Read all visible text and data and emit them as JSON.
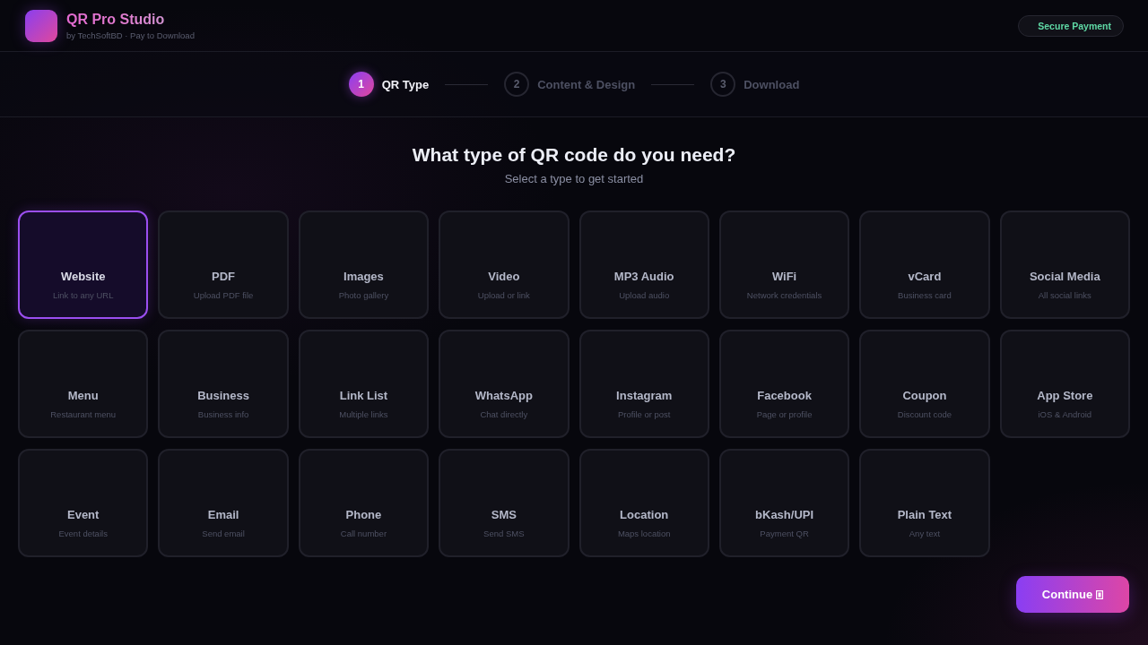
{
  "header": {
    "title": "QR Pro Studio",
    "subtitle": "by TechSoftBD · Pay to Download",
    "badge": "Secure Payment"
  },
  "steps": [
    {
      "number": "1",
      "label": "QR Type",
      "selected": true
    },
    {
      "number": "2",
      "label": "Content & Design",
      "selected": false
    },
    {
      "number": "3",
      "label": "Download",
      "selected": false
    }
  ],
  "heading": "What type of QR code do you need?",
  "subheading": "Select a type to get started",
  "qr_types": [
    {
      "title": "Website",
      "description": "Link to any URL",
      "selected": true
    },
    {
      "title": "PDF",
      "description": "Upload PDF file",
      "selected": false
    },
    {
      "title": "Images",
      "description": "Photo gallery",
      "selected": false
    },
    {
      "title": "Video",
      "description": "Upload or link",
      "selected": false
    },
    {
      "title": "MP3 Audio",
      "description": "Upload audio",
      "selected": false
    },
    {
      "title": "WiFi",
      "description": "Network credentials",
      "selected": false
    },
    {
      "title": "vCard",
      "description": "Business card",
      "selected": false
    },
    {
      "title": "Social Media",
      "description": "All social links",
      "selected": false
    },
    {
      "title": "Menu",
      "description": "Restaurant menu",
      "selected": false
    },
    {
      "title": "Business",
      "description": "Business info",
      "selected": false
    },
    {
      "title": "Link List",
      "description": "Multiple links",
      "selected": false
    },
    {
      "title": "WhatsApp",
      "description": "Chat directly",
      "selected": false
    },
    {
      "title": "Instagram",
      "description": "Profile or post",
      "selected": false
    },
    {
      "title": "Facebook",
      "description": "Page or profile",
      "selected": false
    },
    {
      "title": "Coupon",
      "description": "Discount code",
      "selected": false
    },
    {
      "title": "App Store",
      "description": "iOS & Android",
      "selected": false
    },
    {
      "title": "Event",
      "description": "Event details",
      "selected": false
    },
    {
      "title": "Email",
      "description": "Send email",
      "selected": false
    },
    {
      "title": "Phone",
      "description": "Call number",
      "selected": false
    },
    {
      "title": "SMS",
      "description": "Send SMS",
      "selected": false
    },
    {
      "title": "Location",
      "description": "Maps location",
      "selected": false
    },
    {
      "title": "bKash/UPI",
      "description": "Payment QR",
      "selected": false
    },
    {
      "title": "Plain Text",
      "description": "Any text",
      "selected": false
    }
  ],
  "continue_button": {
    "label": "Continue"
  }
}
